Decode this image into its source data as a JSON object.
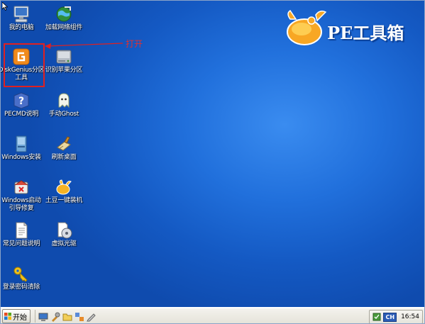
{
  "desktop": {
    "logo_text": "PE工具箱",
    "annotation_text": "打开",
    "icons": [
      {
        "label": "我的电脑",
        "icon": "computer-icon"
      },
      {
        "label": "加载网络组件",
        "icon": "network-globe-icon"
      },
      {
        "label": "DiskGenius分区\n工具",
        "icon": "diskgenius-icon"
      },
      {
        "label": "识别苹果分区",
        "icon": "hard-drive-icon"
      },
      {
        "label": "PECMD说明",
        "icon": "help-icon"
      },
      {
        "label": "手动Ghost",
        "icon": "ghost-icon"
      },
      {
        "label": "Windows安装",
        "icon": "windows-install-icon"
      },
      {
        "label": "刷新桌面",
        "icon": "refresh-desktop-icon"
      },
      {
        "label": "Windows启动\n引导修复",
        "icon": "boot-repair-icon"
      },
      {
        "label": "土豆一键装机",
        "icon": "potato-install-icon"
      },
      {
        "label": "常见问题说明",
        "icon": "document-icon"
      },
      {
        "label": "虚拟光驱",
        "icon": "virtual-drive-icon"
      },
      {
        "label": "登录密码清除",
        "icon": "key-icon"
      }
    ]
  },
  "taskbar": {
    "start_label": "开始",
    "tray_lang": "CH",
    "clock": "16:54"
  },
  "colors": {
    "desktop_blue": "#1a62c7",
    "highlight_red": "#e02020",
    "logo_orange": "#f39a1e"
  }
}
